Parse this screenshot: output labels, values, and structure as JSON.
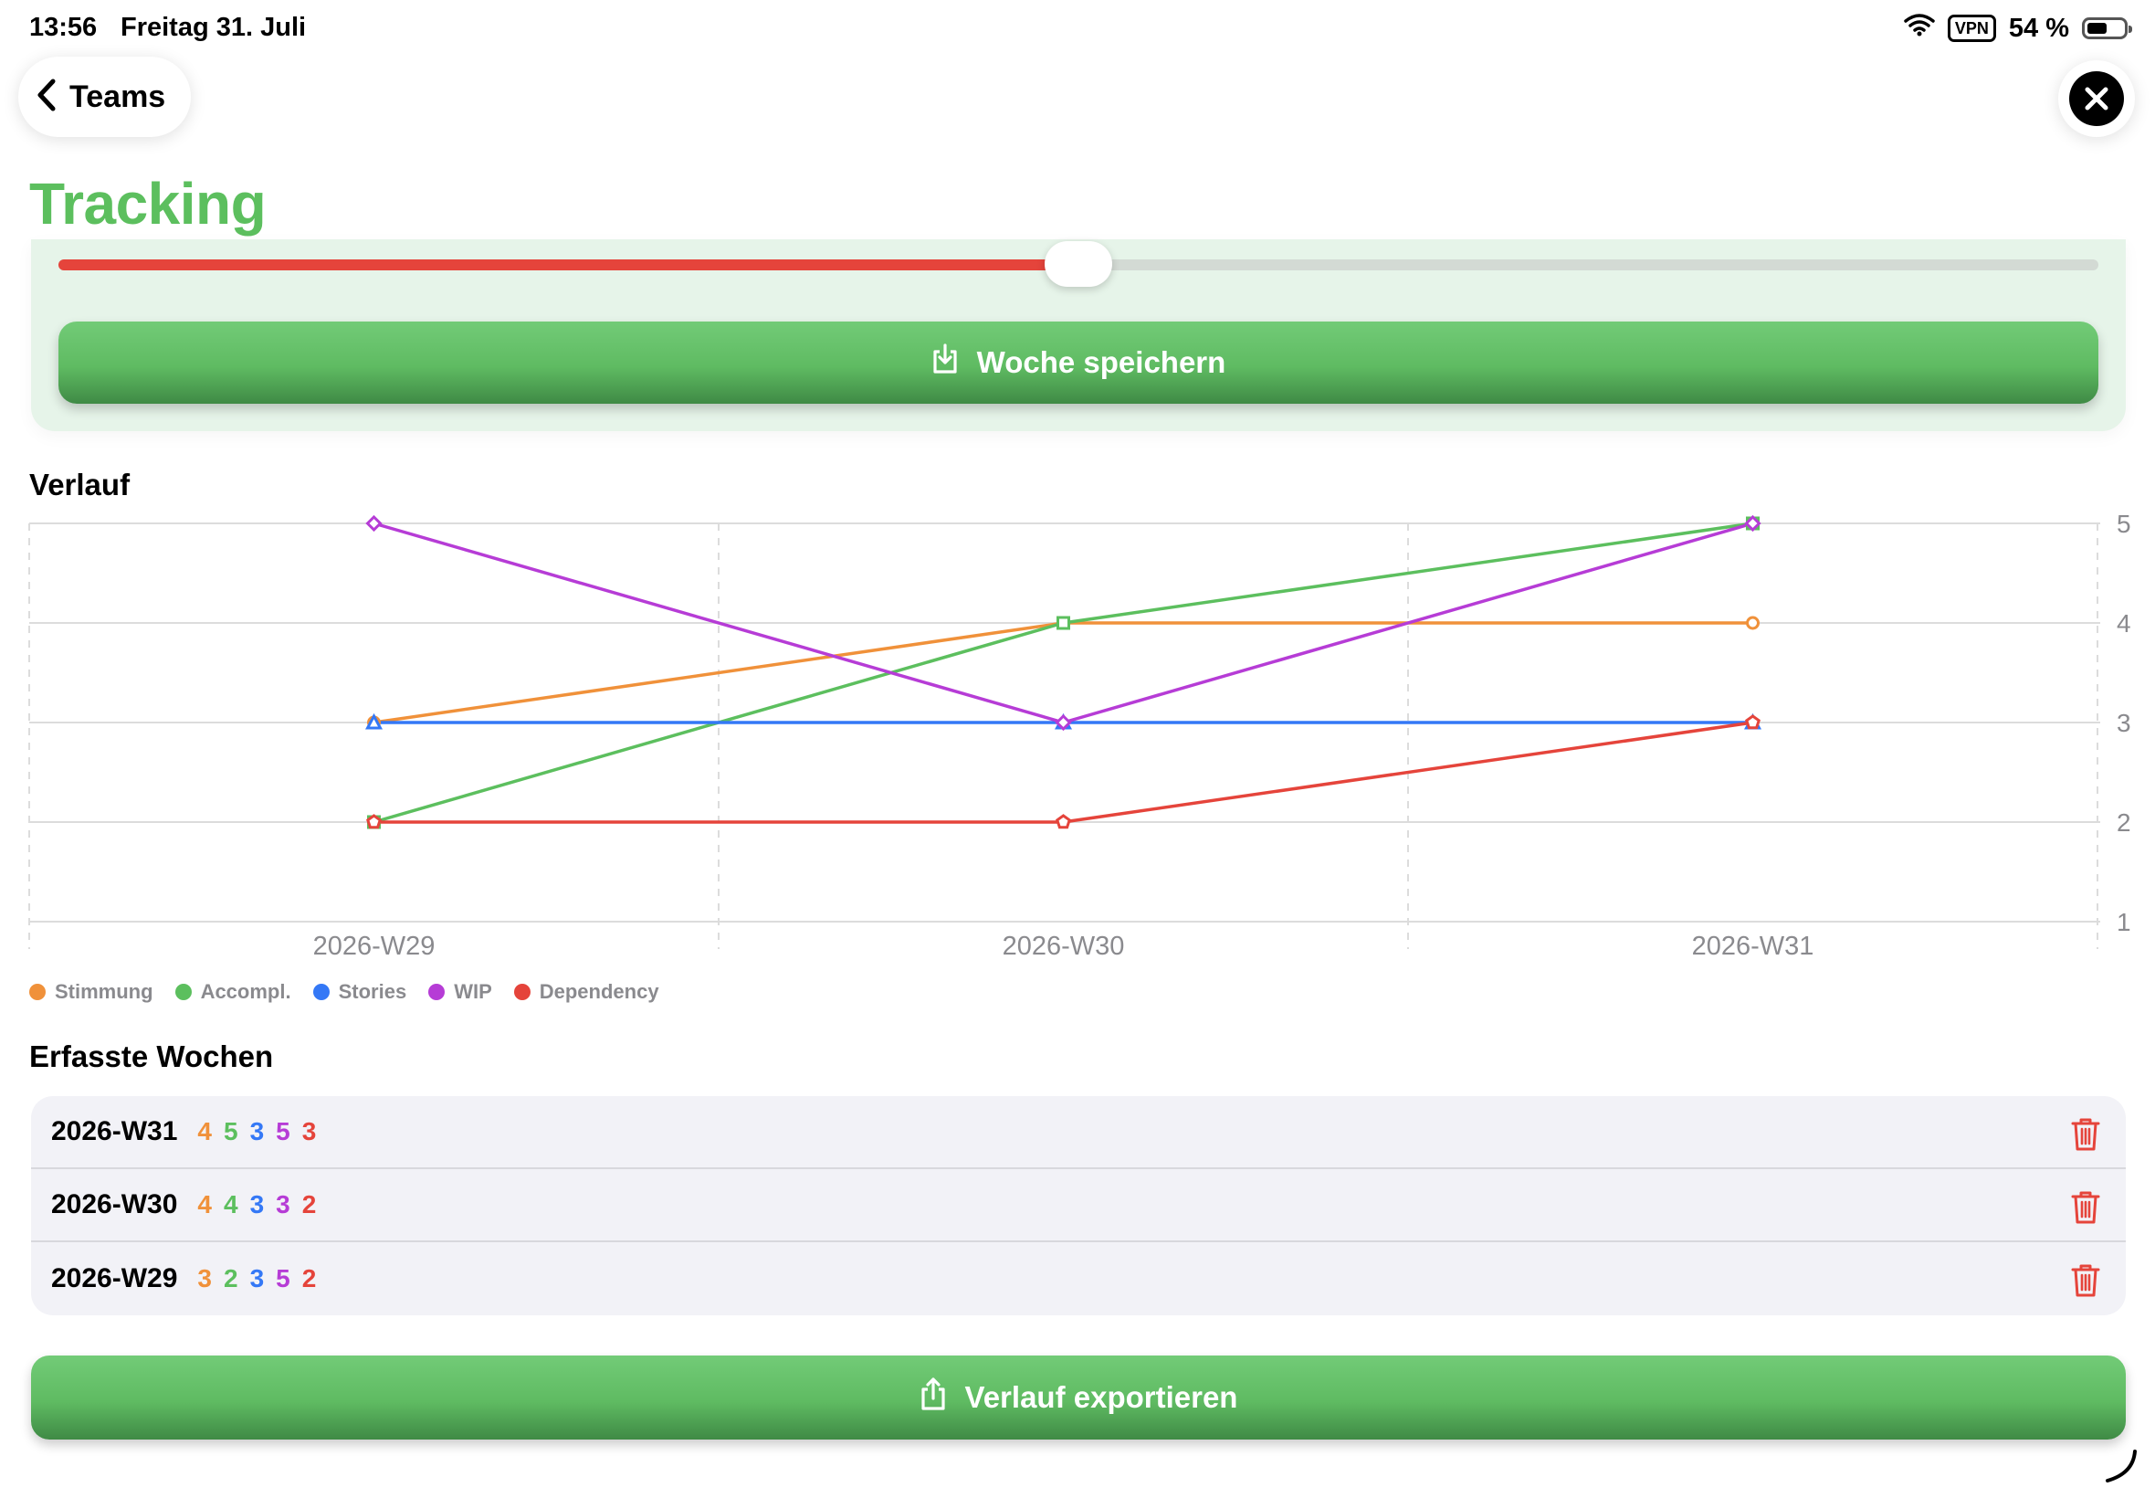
{
  "status": {
    "time": "13:56",
    "date": "Freitag 31. Juli",
    "vpn": "VPN",
    "battery": "54 %",
    "battery_level": 0.54
  },
  "nav": {
    "back_label": "Teams"
  },
  "page": {
    "title": "Tracking"
  },
  "form": {
    "slider_value": 0.5,
    "save_label": "Woche speichern"
  },
  "history": {
    "title": "Verlauf"
  },
  "chart_data": {
    "type": "line",
    "x": [
      "2026-W29",
      "2026-W30",
      "2026-W31"
    ],
    "ylim": [
      1,
      5
    ],
    "yticks": [
      "1",
      "2",
      "3",
      "4",
      "5"
    ],
    "grid": true,
    "legend_position": "bottom-left",
    "series": [
      {
        "name": "Stimmung",
        "color": "#f0913a",
        "marker": "circle",
        "values": [
          3,
          4,
          4
        ]
      },
      {
        "name": "Accompl.",
        "color": "#5cbf5e",
        "marker": "square",
        "values": [
          2,
          4,
          5
        ]
      },
      {
        "name": "Stories",
        "color": "#3478f6",
        "marker": "triangle",
        "values": [
          3,
          3,
          3
        ]
      },
      {
        "name": "WIP",
        "color": "#b63cd6",
        "marker": "diamond",
        "values": [
          5,
          3,
          5
        ]
      },
      {
        "name": "Dependency",
        "color": "#e5443b",
        "marker": "pentagon",
        "values": [
          2,
          2,
          3
        ]
      }
    ]
  },
  "weeks": {
    "title": "Erfasste Wochen",
    "rows": [
      {
        "week": "2026-W31",
        "values": [
          "4",
          "5",
          "3",
          "5",
          "3"
        ]
      },
      {
        "week": "2026-W30",
        "values": [
          "4",
          "4",
          "3",
          "3",
          "2"
        ]
      },
      {
        "week": "2026-W29",
        "values": [
          "3",
          "2",
          "3",
          "5",
          "2"
        ]
      }
    ]
  },
  "export": {
    "label": "Verlauf exportieren"
  }
}
